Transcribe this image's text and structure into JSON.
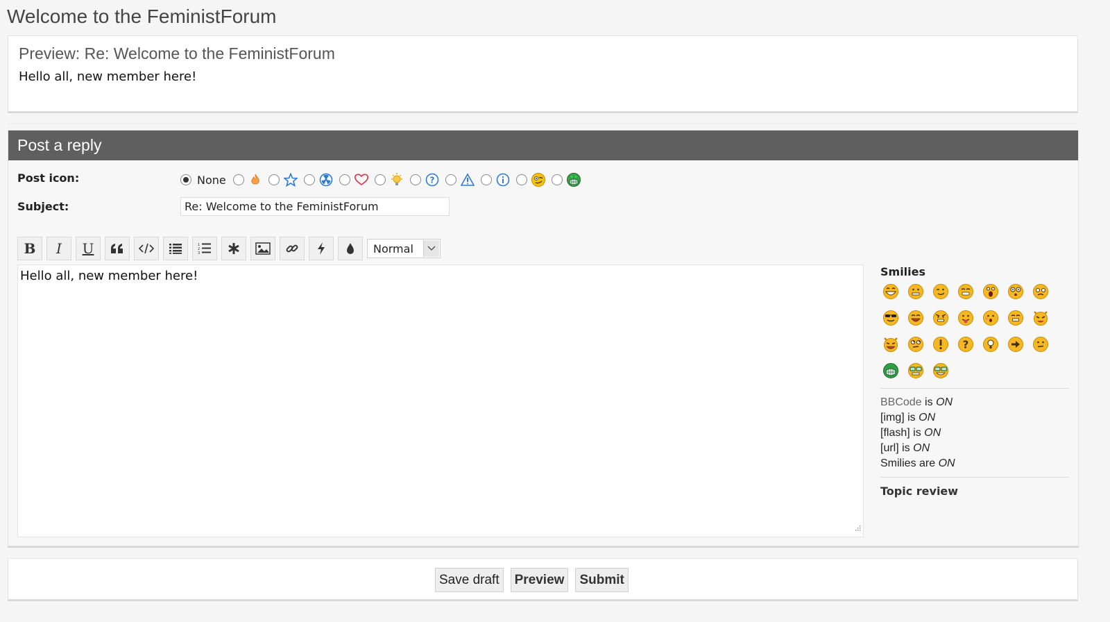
{
  "page": {
    "title": "Welcome to the FeministForum"
  },
  "preview": {
    "title": "Preview: Re: Welcome to the FeministForum",
    "body": "Hello all, new member here!"
  },
  "reply": {
    "header": "Post a reply",
    "post_icon_label": "Post icon:",
    "post_icon_none": "None",
    "post_icons": [
      "flame-icon",
      "star-icon",
      "radioactive-icon",
      "heart-icon",
      "lightbulb-icon",
      "question-icon",
      "warning-icon",
      "info-icon",
      "smiley-wink-icon",
      "grinning-icon"
    ],
    "subject_label": "Subject:",
    "subject_value": "Re: Welcome to the FeministForum",
    "font_size_selected": "Normal",
    "message": "Hello all, new member here!"
  },
  "toolbar": {
    "buttons": [
      "bold",
      "italic",
      "underline",
      "quote",
      "code",
      "list",
      "numbered-list",
      "list-item",
      "image",
      "link",
      "flash",
      "color"
    ]
  },
  "sidebar": {
    "smilies_title": "Smilies",
    "status": {
      "bbcode": "BBCode",
      "bbcode_is": "is",
      "bbcode_val": "ON",
      "img": "[img] is",
      "img_val": "ON",
      "flash": "[flash] is",
      "flash_val": "ON",
      "url": "[url] is",
      "url_val": "ON",
      "smilies": "Smilies are",
      "smilies_val": "ON"
    },
    "topic_review": "Topic review"
  },
  "buttons": {
    "save_draft": "Save draft",
    "preview": "Preview",
    "submit": "Submit"
  },
  "colors": {
    "header_bg": "#5f5f5f",
    "smiley_yellow": "#f4b400",
    "icon_blue": "#2b7bd3"
  }
}
